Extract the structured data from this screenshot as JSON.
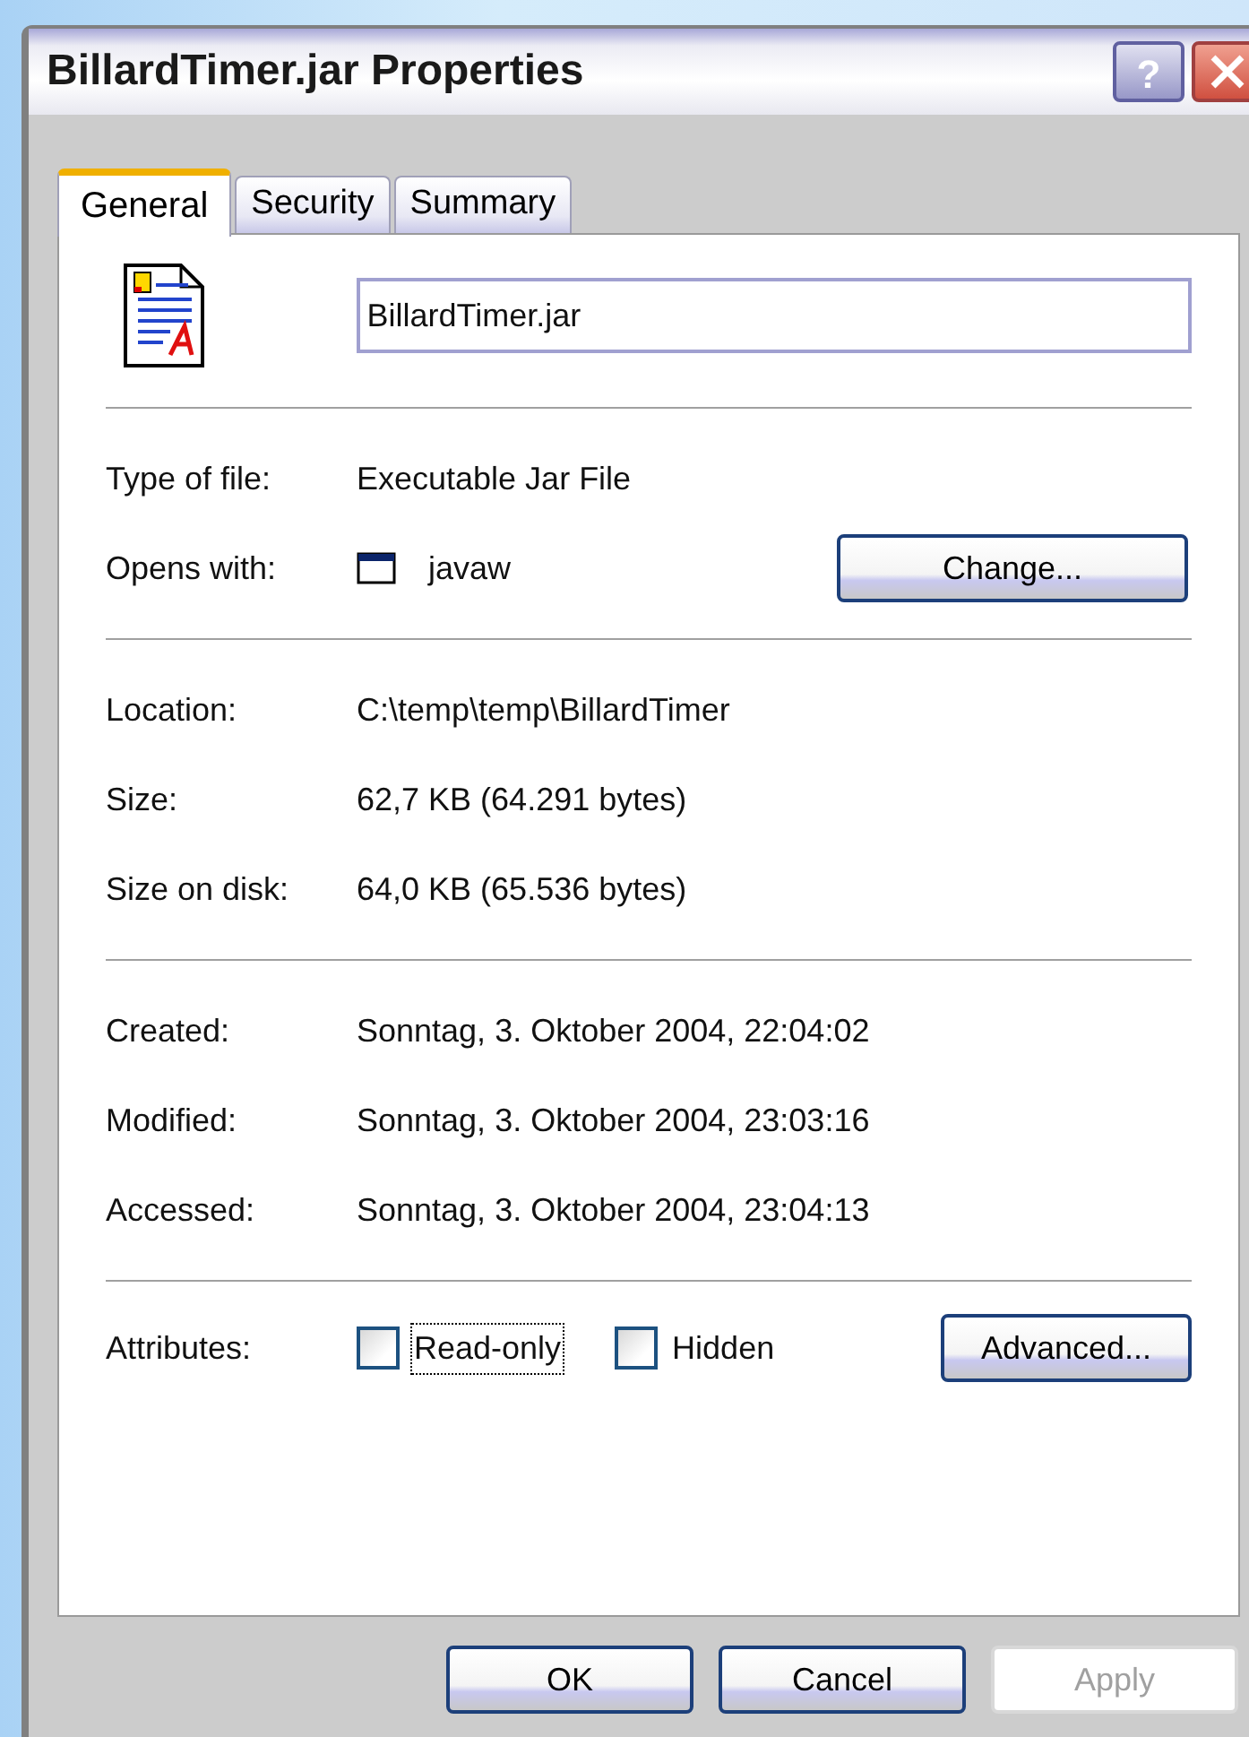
{
  "window": {
    "title": "BillardTimer.jar Properties",
    "help_button": "?"
  },
  "tabs": [
    {
      "label": "General",
      "selected": true
    },
    {
      "label": "Security",
      "selected": false
    },
    {
      "label": "Summary",
      "selected": false
    }
  ],
  "file_name": {
    "value": "BillardTimer.jar"
  },
  "sections": [
    {
      "rows": [
        {
          "kind": "text",
          "label": "Type of file:",
          "value": "Executable Jar File"
        },
        {
          "kind": "app",
          "label": "Opens with:",
          "value": "javaw",
          "button": "Change..."
        }
      ]
    },
    {
      "rows": [
        {
          "kind": "text",
          "label": "Location:",
          "value": "C:\\temp\\temp\\BillardTimer"
        },
        {
          "kind": "text",
          "label": "Size:",
          "value": "62,7 KB (64.291 bytes)"
        },
        {
          "kind": "text",
          "label": "Size on disk:",
          "value": "64,0 KB (65.536 bytes)"
        }
      ]
    },
    {
      "rows": [
        {
          "kind": "text",
          "label": "Created:",
          "value": "Sonntag, 3. Oktober 2004, 22:04:02"
        },
        {
          "kind": "text",
          "label": "Modified:",
          "value": "Sonntag, 3. Oktober 2004, 23:03:16"
        },
        {
          "kind": "text",
          "label": "Accessed:",
          "value": "Sonntag, 3. Oktober 2004, 23:04:13"
        }
      ]
    }
  ],
  "attributes": {
    "label": "Attributes:",
    "checkboxes": [
      {
        "label": "Read-only",
        "checked": false,
        "focused": true
      },
      {
        "label": "Hidden",
        "checked": false,
        "focused": false
      }
    ],
    "button": "Advanced..."
  },
  "buttons": [
    {
      "label": "OK",
      "disabled": false
    },
    {
      "label": "Cancel",
      "disabled": false
    },
    {
      "label": "Apply",
      "disabled": true
    }
  ]
}
